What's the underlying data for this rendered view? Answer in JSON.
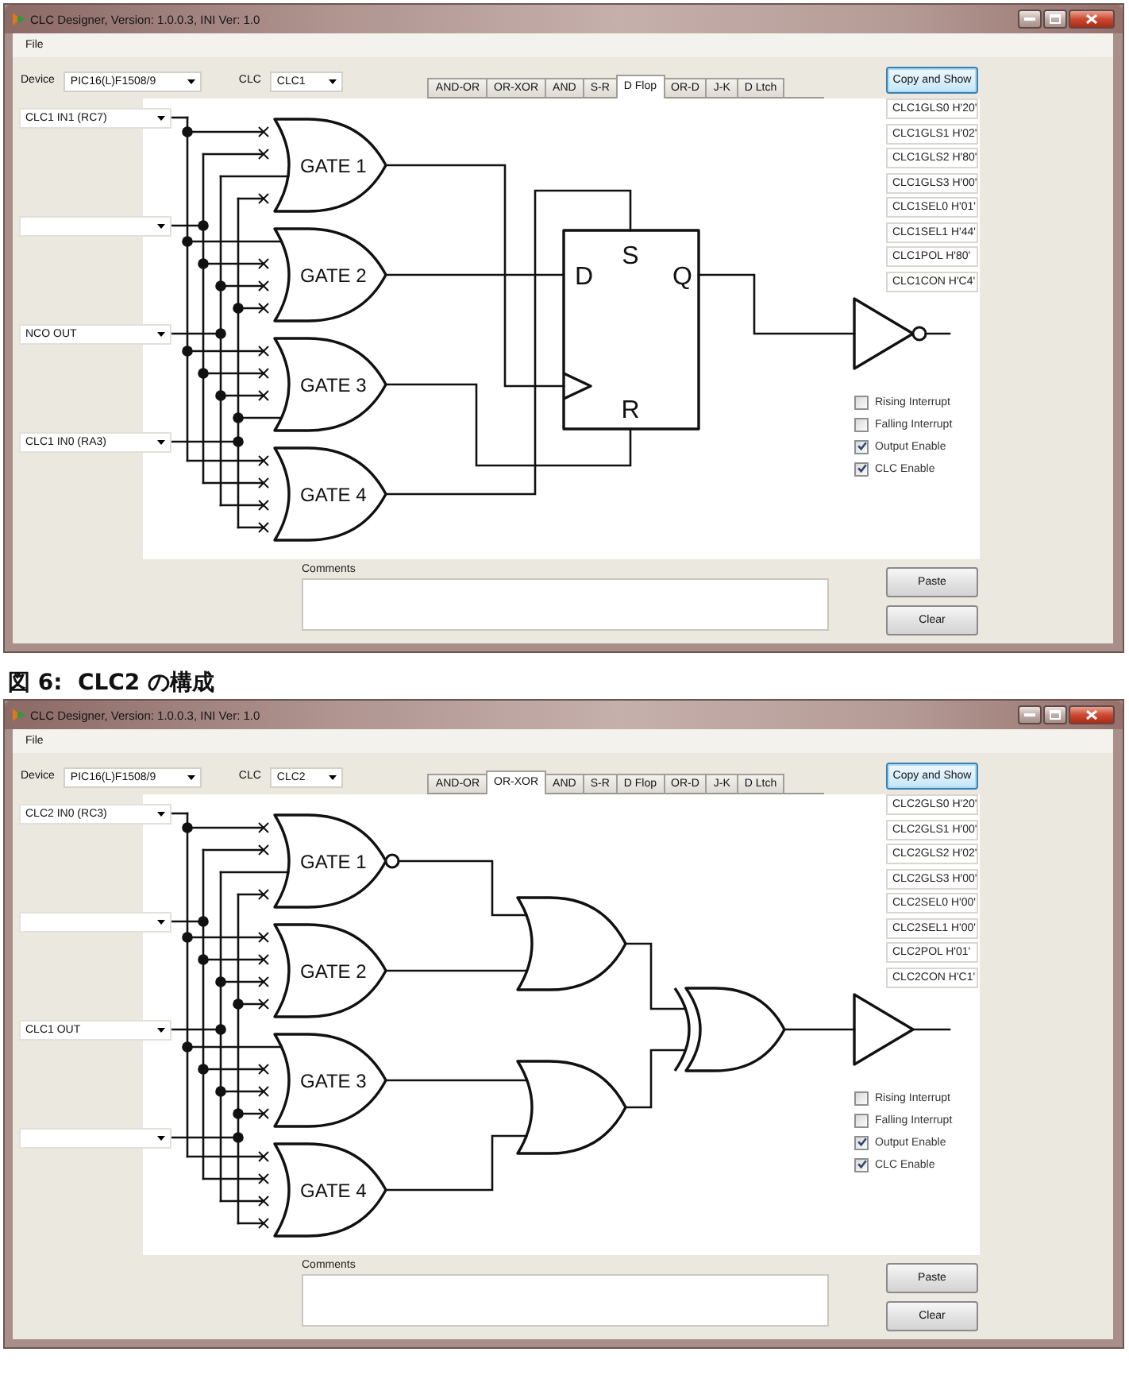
{
  "figure_parts": [
    {
      "kind": "window",
      "title": "CLC Designer, Version: 1.0.0.3, INI Ver: 1.0",
      "menu": [
        "File"
      ],
      "device": {
        "label": "Device",
        "value": "PIC16(L)F1508/9"
      },
      "clc": {
        "label": "CLC",
        "value": "CLC1"
      },
      "tabs": [
        {
          "label": "AND-OR",
          "selected": false
        },
        {
          "label": "OR-XOR",
          "selected": false
        },
        {
          "label": "AND",
          "selected": false
        },
        {
          "label": "S-R",
          "selected": false
        },
        {
          "label": "D Flop",
          "selected": true
        },
        {
          "label": "OR-D",
          "selected": false
        },
        {
          "label": "J-K",
          "selected": false
        },
        {
          "label": "D Ltch",
          "selected": false
        }
      ],
      "copy_button": "Copy and Show",
      "data_inputs": [
        {
          "kind": "dropdown",
          "value": "CLC1 IN1 (RC7)"
        },
        {
          "kind": "dropdown"
        },
        {
          "kind": "dropdown",
          "value": "NCO OUT"
        },
        {
          "kind": "dropdown",
          "value": "CLC1 IN0 (RA3)"
        }
      ],
      "gates": [
        {
          "label": "GATE 1",
          "inverted": false,
          "inputs": [
            {
              "connected": false
            },
            {
              "connected": false
            },
            {
              "connected": true
            },
            {
              "connected": false
            }
          ]
        },
        {
          "label": "GATE 2",
          "inverted": false,
          "inputs": [
            {
              "connected": true
            },
            {
              "connected": false
            },
            {
              "connected": false
            },
            {
              "connected": false
            }
          ]
        },
        {
          "label": "GATE 3",
          "inverted": false,
          "inputs": [
            {
              "connected": false
            },
            {
              "connected": false
            },
            {
              "connected": false
            },
            {
              "connected": true
            }
          ]
        },
        {
          "label": "GATE 4",
          "inverted": false,
          "inputs": [
            {
              "connected": false
            },
            {
              "connected": false
            },
            {
              "connected": false
            },
            {
              "connected": false
            }
          ]
        }
      ],
      "output_logic": {
        "kind": "d-flop",
        "pin_labels": [
          "S",
          "D",
          "Q",
          "R"
        ]
      },
      "output_inverted": true,
      "registers": [
        "CLC1GLS0 H'20'",
        "CLC1GLS1 H'02'",
        "CLC1GLS2 H'80'",
        "CLC1GLS3 H'00'",
        "CLC1SEL0 H'01'",
        "CLC1SEL1 H'44'",
        "CLC1POL H'80'",
        "CLC1CON H'C4'"
      ],
      "options": [
        {
          "label": "Rising Interrupt",
          "checked": false
        },
        {
          "label": "Falling Interrupt",
          "checked": false
        },
        {
          "label": "Output Enable",
          "checked": true
        },
        {
          "label": "CLC Enable",
          "checked": true
        }
      ],
      "comments": {
        "label": "Comments"
      },
      "paste_button": "Paste",
      "clear_button": "Clear"
    },
    {
      "kind": "caption",
      "text": "図 6:  CLC2 の構成"
    },
    {
      "kind": "window",
      "title": "CLC Designer, Version: 1.0.0.3, INI Ver: 1.0",
      "menu": [
        "File"
      ],
      "device": {
        "label": "Device",
        "value": "PIC16(L)F1508/9"
      },
      "clc": {
        "label": "CLC",
        "value": "CLC2"
      },
      "tabs": [
        {
          "label": "AND-OR",
          "selected": false
        },
        {
          "label": "OR-XOR",
          "selected": true
        },
        {
          "label": "AND",
          "selected": false
        },
        {
          "label": "S-R",
          "selected": false
        },
        {
          "label": "D Flop",
          "selected": false
        },
        {
          "label": "OR-D",
          "selected": false
        },
        {
          "label": "J-K",
          "selected": false
        },
        {
          "label": "D Ltch",
          "selected": false
        }
      ],
      "copy_button": "Copy and Show",
      "data_inputs": [
        {
          "kind": "dropdown",
          "value": "CLC2 IN0 (RC3)"
        },
        {
          "kind": "dropdown"
        },
        {
          "kind": "dropdown",
          "value": "CLC1 OUT"
        },
        {
          "kind": "dropdown"
        }
      ],
      "gates": [
        {
          "label": "GATE 1",
          "inverted": true,
          "inputs": [
            {
              "connected": false
            },
            {
              "connected": false
            },
            {
              "connected": true
            },
            {
              "connected": false
            }
          ]
        },
        {
          "label": "GATE 2",
          "inverted": false,
          "inputs": [
            {
              "connected": false
            },
            {
              "connected": false
            },
            {
              "connected": false
            },
            {
              "connected": false
            }
          ]
        },
        {
          "label": "GATE 3",
          "inverted": false,
          "inputs": [
            {
              "connected": true
            },
            {
              "connected": false
            },
            {
              "connected": false
            },
            {
              "connected": false
            }
          ]
        },
        {
          "label": "GATE 4",
          "inverted": false,
          "inputs": [
            {
              "connected": false
            },
            {
              "connected": false
            },
            {
              "connected": false
            },
            {
              "connected": false
            }
          ]
        }
      ],
      "output_logic": {
        "kind": "or-xor"
      },
      "output_inverted": false,
      "registers": [
        "CLC2GLS0 H'20'",
        "CLC2GLS1 H'00'",
        "CLC2GLS2 H'02'",
        "CLC2GLS3 H'00'",
        "CLC2SEL0 H'00'",
        "CLC2SEL1 H'00'",
        "CLC2POL H'01'",
        "CLC2CON H'C1'"
      ],
      "options": [
        {
          "label": "Rising Interrupt",
          "checked": false
        },
        {
          "label": "Falling Interrupt",
          "checked": false
        },
        {
          "label": "Output Enable",
          "checked": true
        },
        {
          "label": "CLC Enable",
          "checked": true
        }
      ],
      "comments": {
        "label": "Comments"
      },
      "paste_button": "Paste",
      "clear_button": "Clear"
    }
  ]
}
